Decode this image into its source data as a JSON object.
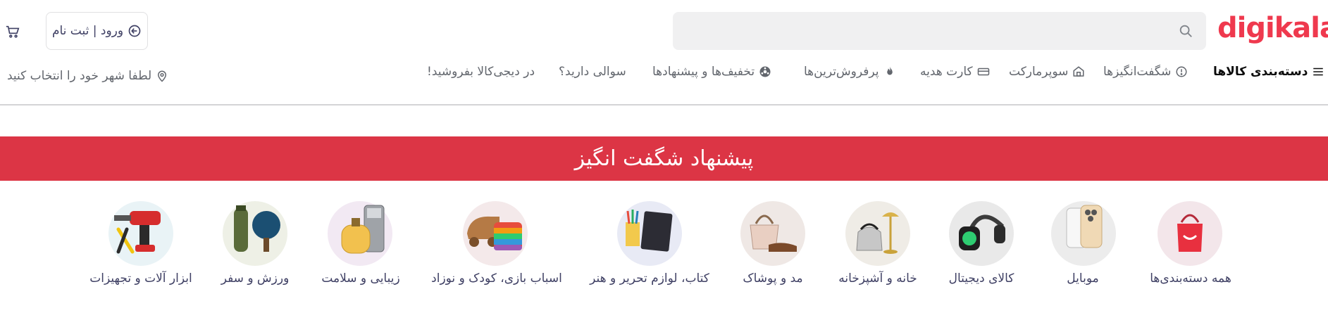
{
  "header": {
    "logo_text": "digikala",
    "search_placeholder": "",
    "login_label": "ورود | ثبت نام",
    "icons": {
      "search": "search-icon",
      "login": "login-arrow-icon",
      "cart": "cart-icon"
    },
    "brand_color": "#ef394e"
  },
  "nav": {
    "categories_label": "دسته‌بندی کالاها",
    "items": [
      {
        "label": "شگفت‌انگیزها",
        "icon": "discount-badge-icon"
      },
      {
        "label": "سوپرمارکت",
        "icon": "shop-icon"
      },
      {
        "label": "کارت هدیه",
        "icon": "gift-card-icon"
      },
      {
        "label": "پرفروش‌ترین‌ها",
        "icon": "fire-icon"
      },
      {
        "label": "تخفیف‌ها و پیشنهادها",
        "icon": "percent-icon"
      },
      {
        "label": "سوالی دارید؟",
        "icon": ""
      },
      {
        "label": "در دیجی‌کالا بفروشید!",
        "icon": ""
      }
    ],
    "location_label": "لطفا شهر خود را انتخاب کنید"
  },
  "banner": {
    "title": "پیشنهاد شگفت انگیز",
    "color": "#dc3545"
  },
  "categories": [
    {
      "label": "همه دسته‌بندی‌ها",
      "icon": "shopping-bag-icon"
    },
    {
      "label": "موبایل",
      "icon": "mobile-phones-icon"
    },
    {
      "label": "کالای دیجیتال",
      "icon": "headphones-watch-icon"
    },
    {
      "label": "خانه و آشپزخانه",
      "icon": "kettle-lamp-icon"
    },
    {
      "label": "مد و پوشاک",
      "icon": "handbag-shoes-icon"
    },
    {
      "label": "کتاب، لوازم تحریر و هنر",
      "icon": "notebook-pencils-icon"
    },
    {
      "label": "اسباب بازی، کودک و نوزاد",
      "icon": "toy-car-popit-icon"
    },
    {
      "label": "زیبایی و سلامت",
      "icon": "perfume-shaver-icon"
    },
    {
      "label": "ورزش و سفر",
      "icon": "pingpong-bottle-icon"
    },
    {
      "label": "ابزار آلات و تجهیزات",
      "icon": "drill-pliers-icon"
    }
  ]
}
